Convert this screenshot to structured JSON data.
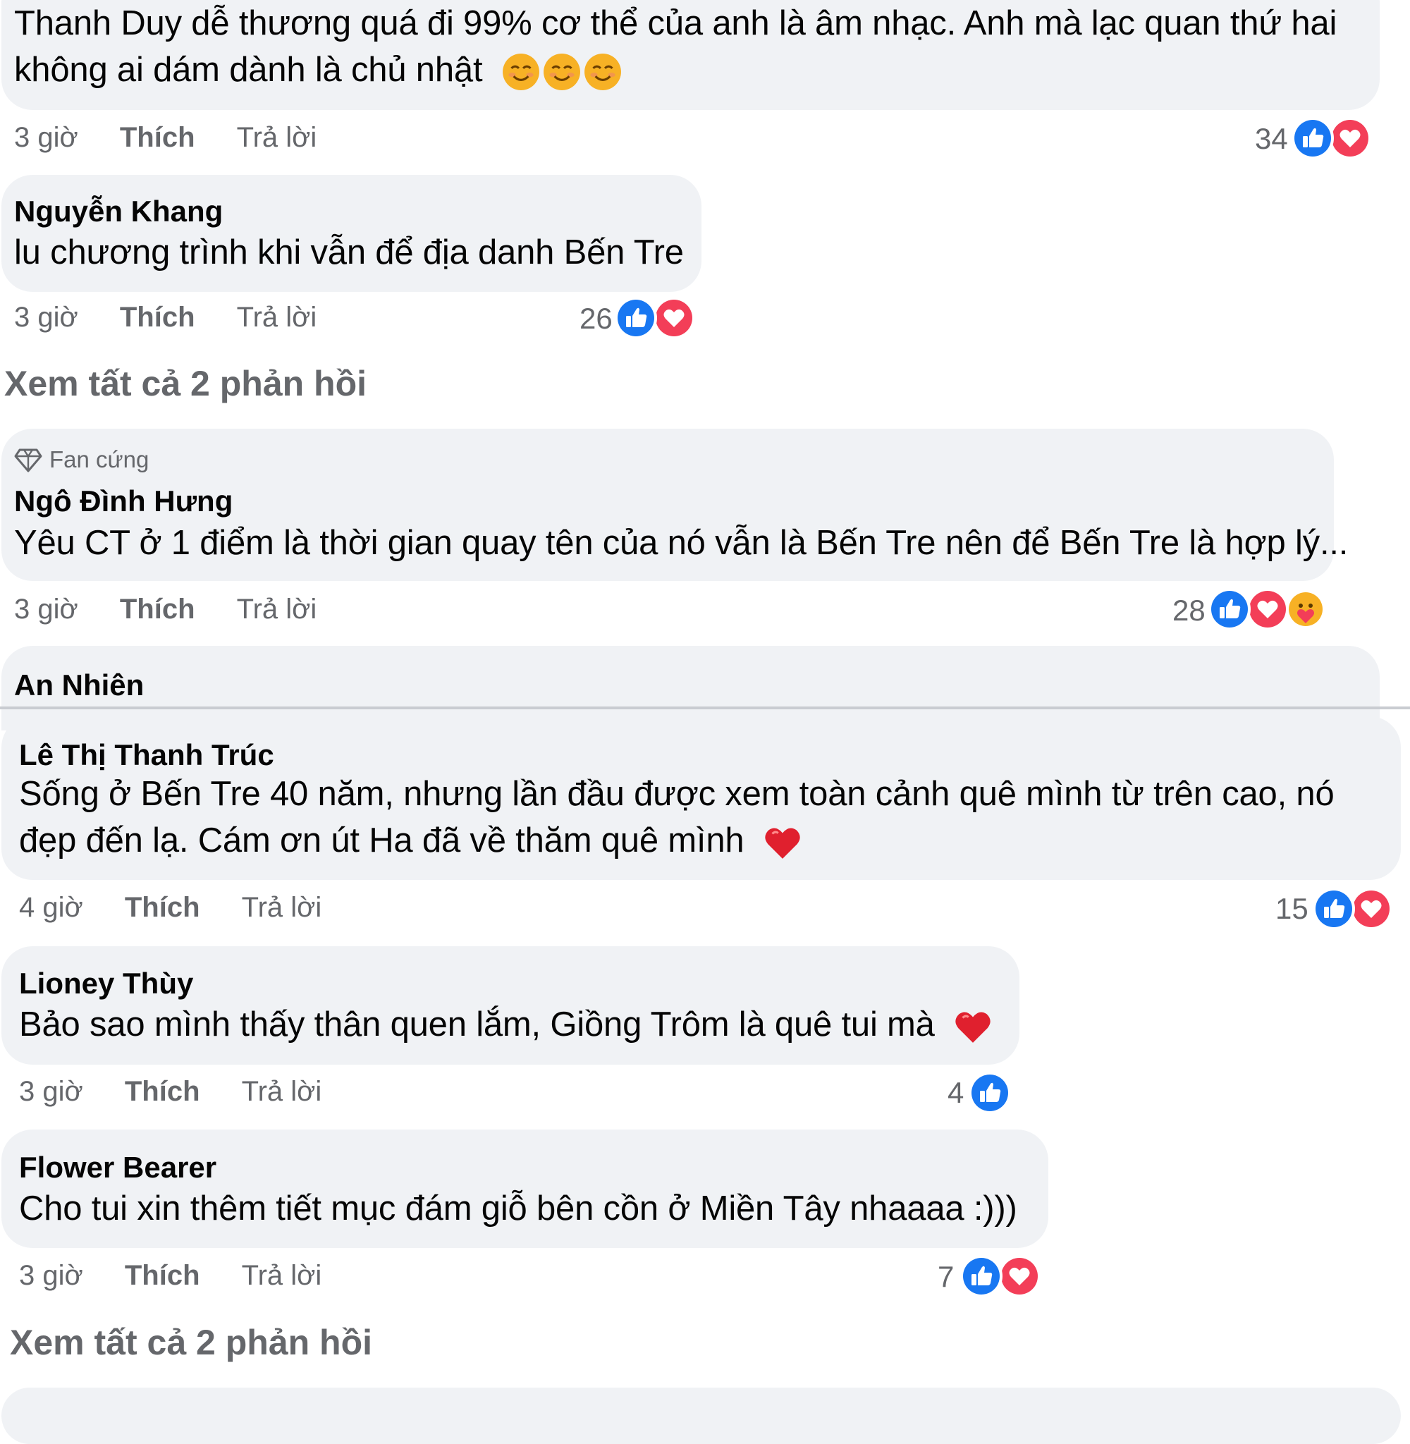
{
  "actions": {
    "like": "Thích",
    "reply": "Trả lời"
  },
  "comments": [
    {
      "lines": [
        "Thanh Duy dễ thương quá đi 99% cơ thể của anh là âm nhạc. Anh mà lạc quan thứ hai",
        "không ai dám dành là chủ nhật"
      ],
      "emoji": [
        "smiling-face-icon",
        "smiling-face-icon",
        "smiling-face-icon"
      ],
      "time": "3 giờ",
      "reaction_count": "34",
      "reactions": [
        "like",
        "love"
      ]
    },
    {
      "name": "Nguyễn Khang",
      "lines": [
        "lu chương trình khi vẫn để địa danh Bến Tre"
      ],
      "time": "3 giờ",
      "reaction_count": "26",
      "reactions": [
        "like",
        "love"
      ]
    },
    {
      "badge": "Fan cứng",
      "name": "Ngô Đình Hưng",
      "lines": [
        "Yêu CT ở 1 điểm là thời gian quay tên của nó vẫn là Bến Tre nên để Bến Tre là hợp lý..."
      ],
      "time": "3 giờ",
      "reaction_count": "28",
      "reactions": [
        "like",
        "love",
        "care"
      ]
    },
    {
      "name": "An Nhiên"
    },
    {
      "name": "Lê Thị Thanh Trúc",
      "lines": [
        "Sống ở Bến Tre 40 năm, nhưng lần đầu được xem toàn cảnh quê mình từ trên cao, nó",
        "đẹp đến lạ. Cám ơn út Ha đã về thăm quê mình"
      ],
      "emoji": [
        "heart-icon"
      ],
      "time": "4 giờ",
      "reaction_count": "15",
      "reactions": [
        "like",
        "love"
      ]
    },
    {
      "name": "Lioney Thùy",
      "lines": [
        "Bảo sao mình thấy thân quen lắm, Giồng Trôm là quê tui mà"
      ],
      "emoji": [
        "heart-icon"
      ],
      "time": "3 giờ",
      "reaction_count": "4",
      "reactions": [
        "like"
      ]
    },
    {
      "name": "Flower Bearer",
      "lines": [
        "Cho tui xin thêm tiết mục đám giỗ bên cồn ở Miền Tây nhaaaa :)))"
      ],
      "time": "3 giờ",
      "reaction_count": "7",
      "reactions": [
        "like",
        "love"
      ]
    }
  ],
  "view_replies": [
    "Xem tất cả 2 phản hồi",
    "Xem tất cả 2 phản hồi"
  ],
  "colors": {
    "bubble": "#f0f2f5",
    "like": "#1877f2",
    "love": "#f33e58",
    "care": "#f7b125",
    "meta": "#65676b"
  }
}
